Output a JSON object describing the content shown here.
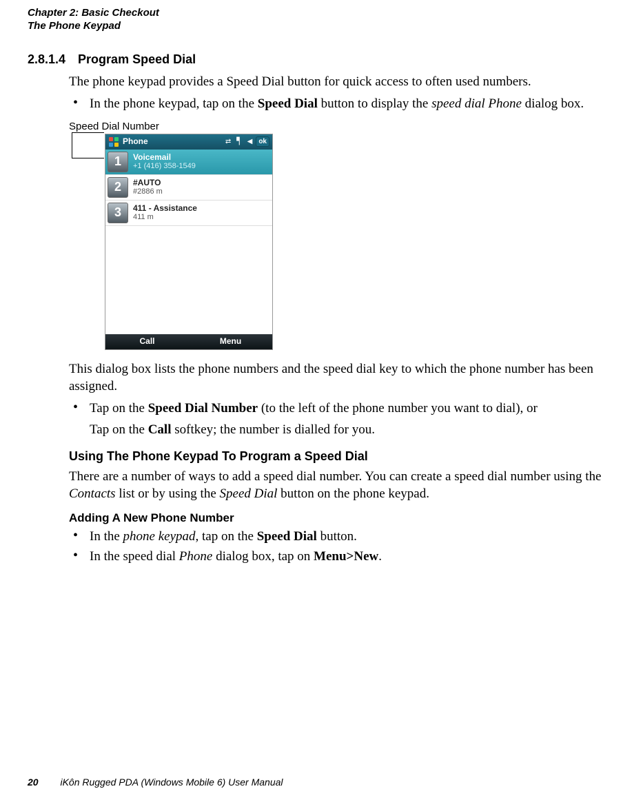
{
  "header": {
    "line1": "Chapter 2: Basic Checkout",
    "line2": "The Phone Keypad"
  },
  "section": {
    "number": "2.8.1.4",
    "title": "Program Speed Dial"
  },
  "intro_para": "The phone keypad provides a Speed Dial button for quick access to often used numbers.",
  "bullet1": {
    "pre": "In the phone keypad, tap on the ",
    "bold1": "Speed Dial",
    "mid": " button to display the ",
    "italic1": "speed dial Phone",
    "post": " dialog box."
  },
  "figure": {
    "caption": "Speed Dial Number",
    "titlebar": "Phone",
    "ok": "ok",
    "rows": [
      {
        "n": "1",
        "name": "Voicemail",
        "number": "+1 (416) 358-1549",
        "sel": true
      },
      {
        "n": "2",
        "name": "#AUTO",
        "number": "#2886 m",
        "sel": false
      },
      {
        "n": "3",
        "name": "411 - Assistance",
        "number": "411 m",
        "sel": false
      }
    ],
    "softkeys": {
      "left": "Call",
      "right": "Menu"
    }
  },
  "after_figure_para": "This dialog box lists the phone numbers and the speed dial key to which the phone number has been assigned.",
  "bullet2": {
    "line1_pre": "Tap on the ",
    "line1_bold": "Speed Dial Number",
    "line1_post": " (to the left of the phone number you want to dial), or",
    "line2_pre": "Tap on the ",
    "line2_bold": "Call",
    "line2_post": " softkey; the number is dialled for you."
  },
  "subheading1": "Using The Phone Keypad To Program a Speed Dial",
  "sub1_para": {
    "pre": "There are a number of ways to add a speed dial number. You can create a speed dial number using the ",
    "it1": "Contacts",
    "mid": " list or by using the ",
    "it2": "Speed Dial",
    "post": " button on the phone keypad."
  },
  "subheading2": "Adding A New Phone Number",
  "bullets3": {
    "a": {
      "pre": "In the ",
      "it": "phone keypad",
      "mid": ", tap on the ",
      "bold": "Speed Dial",
      "post": " button."
    },
    "b": {
      "pre": "In the speed dial ",
      "it": "Phone",
      "mid": " dialog box, tap on ",
      "bold": "Menu>New",
      "post": "."
    }
  },
  "footer": {
    "page": "20",
    "title": "iKôn Rugged PDA (Windows Mobile 6) User Manual"
  }
}
